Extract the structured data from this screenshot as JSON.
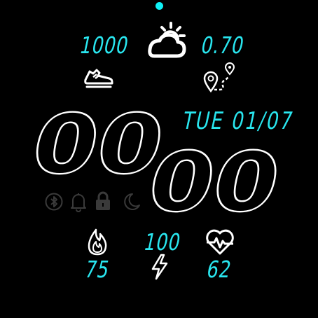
{
  "colors": {
    "accent": "#29e6ef",
    "primary": "#ffffff",
    "muted": "#3a3a3a",
    "background": "#000000"
  },
  "top_indicator": {
    "icon": "page-dot"
  },
  "steps": {
    "value": "1000",
    "icon": "shoe-icon"
  },
  "weather": {
    "icon": "partly-cloudy-icon"
  },
  "distance": {
    "value": "0.70",
    "icon": "route-location-icon"
  },
  "date": {
    "text": "TUE 01/07"
  },
  "time": {
    "hour": "00",
    "minute": "00"
  },
  "status_icons": [
    "bluetooth-icon",
    "bell-icon",
    "lock-icon",
    "moon-icon"
  ],
  "calories": {
    "value": "75",
    "icon": "flame-icon"
  },
  "battery": {
    "value": "100",
    "icon": "lightning-icon"
  },
  "heart_rate": {
    "value": "62",
    "icon": "heart-pulse-icon"
  }
}
